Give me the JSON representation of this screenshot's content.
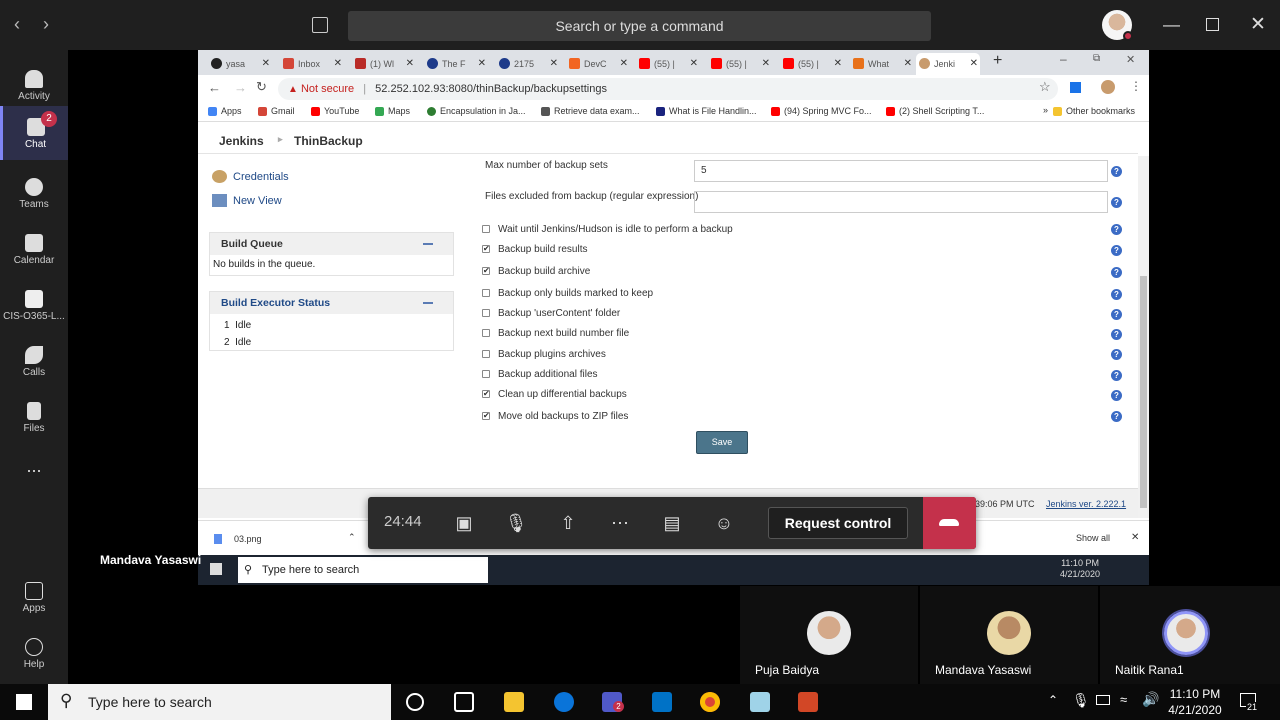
{
  "teams": {
    "search_placeholder": "Search or type a command",
    "sidebar": [
      {
        "label": "Activity"
      },
      {
        "label": "Chat",
        "badge": "2"
      },
      {
        "label": "Teams"
      },
      {
        "label": "Calendar"
      },
      {
        "label": "CIS-O365-L..."
      },
      {
        "label": "Calls"
      },
      {
        "label": "Files"
      },
      {
        "label": "..."
      },
      {
        "label": "Apps"
      },
      {
        "label": "Help"
      }
    ]
  },
  "browser": {
    "tabs": [
      {
        "label": "yasa"
      },
      {
        "label": "Inbox"
      },
      {
        "label": "(1) Wl"
      },
      {
        "label": "The F"
      },
      {
        "label": "2175"
      },
      {
        "label": "DevC"
      },
      {
        "label": "(55) |"
      },
      {
        "label": "(55) |"
      },
      {
        "label": "(55) |"
      },
      {
        "label": "What"
      },
      {
        "label": "Jenki"
      }
    ],
    "not_secure": "Not secure",
    "url": "52.252.102.93:8080/thinBackup/backupsettings",
    "bookmarks": [
      {
        "label": "Apps"
      },
      {
        "label": "Gmail"
      },
      {
        "label": "YouTube"
      },
      {
        "label": "Maps"
      },
      {
        "label": "Encapsulation in Ja..."
      },
      {
        "label": "Retrieve data exam..."
      },
      {
        "label": "What is File Handlin..."
      },
      {
        "label": "(94) Spring MVC Fo..."
      },
      {
        "label": "(2) Shell Scripting T..."
      },
      {
        "label": "Other bookmarks"
      }
    ]
  },
  "jenkins": {
    "breadcrumb": [
      "Jenkins",
      "ThinBackup"
    ],
    "links": {
      "credentials": "Credentials",
      "new_view": "New View"
    },
    "build_queue": {
      "title": "Build Queue",
      "empty": "No builds in the queue."
    },
    "executors": {
      "title": "Build Executor Status",
      "items": [
        {
          "num": "1",
          "status": "Idle"
        },
        {
          "num": "2",
          "status": "Idle"
        }
      ]
    },
    "fields": {
      "max_sets_label": "Max number of backup sets",
      "max_sets_value": "5",
      "excluded_label": "Files excluded from backup (regular expression)",
      "excluded_value": ""
    },
    "options": [
      {
        "label": "Wait until Jenkins/Hudson is idle to perform a backup",
        "mark": ""
      },
      {
        "label": "Backup build results",
        "mark": "✔"
      },
      {
        "label": "Backup build archive",
        "mark": "✔"
      },
      {
        "label": "Backup only builds marked to keep",
        "mark": ""
      },
      {
        "label": "Backup 'userContent' folder",
        "mark": ""
      },
      {
        "label": "Backup next build number file",
        "mark": ""
      },
      {
        "label": "Backup plugins archives",
        "mark": ""
      },
      {
        "label": "Backup additional files",
        "mark": ""
      },
      {
        "label": "Clean up differential backups",
        "mark": "✔"
      },
      {
        "label": "Move old backups to ZIP files",
        "mark": "✔"
      }
    ],
    "save": "Save",
    "footer": {
      "generated": "39:06 PM UTC",
      "version": "Jenkins ver. 2.222.1"
    }
  },
  "downloads": {
    "file": "03.png",
    "show_all": "Show all"
  },
  "inner_taskbar": {
    "search": "Type here to search",
    "time": "11:10 PM",
    "date": "4/21/2020"
  },
  "call": {
    "timer": "24:44",
    "request_control": "Request control",
    "presenter": "Mandava Yasaswi"
  },
  "participants": [
    {
      "name": "Puja Baidya"
    },
    {
      "name": "Mandava Yasaswi"
    },
    {
      "name": "Naitik Rana1"
    }
  ],
  "taskbar": {
    "search": "Type here to search",
    "time": "11:10 PM",
    "date": "4/21/2020",
    "notifications": "21",
    "teams_badge": "2"
  }
}
